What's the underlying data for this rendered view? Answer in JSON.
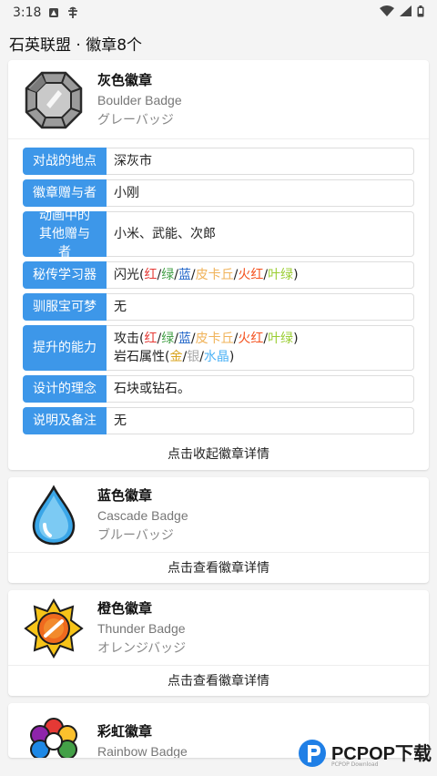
{
  "status_bar": {
    "time": "3:18",
    "icons": [
      "notification-icon",
      "bug-icon"
    ],
    "right_icons": [
      "wifi-icon",
      "signal-icon",
      "battery-icon"
    ]
  },
  "header": {
    "title": "石英联盟 · 徽章8个"
  },
  "badges": [
    {
      "name": "灰色徽章",
      "en": "Boulder Badge",
      "jp": "グレーバッジ",
      "icon": "boulder-badge-icon",
      "expanded": true,
      "details": [
        {
          "label": "对战的地点",
          "value": "深灰市"
        },
        {
          "label": "徽章赠与者",
          "value": "小刚"
        },
        {
          "label": "动画中的其他赠与者",
          "value": "小米、武能、次郎"
        },
        {
          "label": "秘传学习器",
          "value_parts": [
            "闪光(",
            "红",
            "/",
            "绿",
            "/",
            "蓝",
            "/",
            "皮卡丘",
            "/",
            "火红",
            "/",
            "叶绿",
            ")"
          ]
        },
        {
          "label": "驯服宝可梦",
          "value": "无"
        },
        {
          "label": "提升的能力",
          "line1_parts": [
            "攻击(",
            "红",
            "/",
            "绿",
            "/",
            "蓝",
            "/",
            "皮卡丘",
            "/",
            "火红",
            "/",
            "叶绿",
            ")"
          ],
          "line2_parts": [
            "岩石属性(",
            "金",
            "/",
            "银",
            "/",
            "水晶",
            ")"
          ]
        },
        {
          "label": "设计的理念",
          "value": "石块或钻石。"
        },
        {
          "label": "说明及备注",
          "value": "无"
        }
      ],
      "footer": "点击收起徽章详情"
    },
    {
      "name": "蓝色徽章",
      "en": "Cascade Badge",
      "jp": "ブルーバッジ",
      "icon": "cascade-badge-icon",
      "footer": "点击查看徽章详情"
    },
    {
      "name": "橙色徽章",
      "en": "Thunder Badge",
      "jp": "オレンジバッジ",
      "icon": "thunder-badge-icon",
      "footer": "点击查看徽章详情"
    },
    {
      "name": "彩虹徽章",
      "en": "Rainbow Badge",
      "icon": "rainbow-badge-icon"
    }
  ],
  "colors": {
    "accent": "#3d97e9",
    "red": "#e53935",
    "green": "#43a047",
    "blue": "#1e63c8",
    "pikachu": "#f0b35a",
    "firered": "#f4511e",
    "leafgreen": "#9acd32",
    "gold": "#d9a520",
    "silver": "#a8a8a8",
    "crystal": "#4fb3f6"
  },
  "watermark": {
    "text": "PCPOP下载",
    "sub": "PCPOP Download"
  }
}
